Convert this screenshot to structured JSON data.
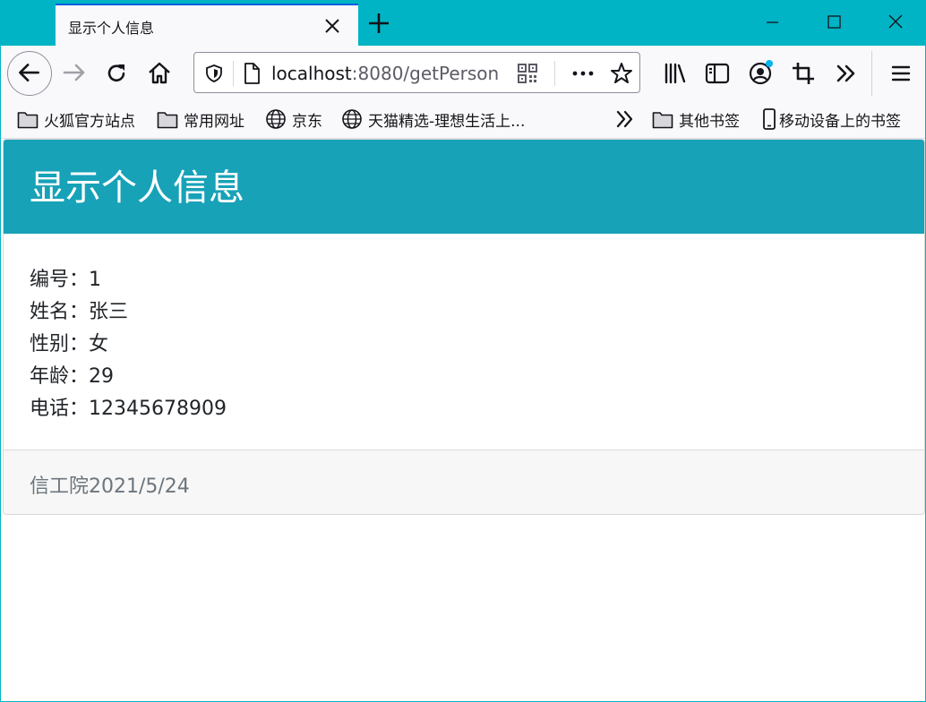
{
  "browser": {
    "tab": {
      "title": "显示个人信息"
    },
    "url": {
      "host": "localhost",
      "path": ":8080/getPerson"
    },
    "bookmarks": [
      {
        "label": "火狐官方站点",
        "icon": "folder-icon"
      },
      {
        "label": "常用网址",
        "icon": "folder-icon"
      },
      {
        "label": "京东",
        "icon": "globe-icon"
      },
      {
        "label": "天猫精选-理想生活上...",
        "icon": "globe-icon"
      },
      {
        "label": "其他书签",
        "icon": "folder-icon"
      },
      {
        "label": "移动设备上的书签",
        "icon": "mobile-icon"
      }
    ],
    "colors": {
      "titlebar": "#00b4c5",
      "accent_dot": "#00b4f0"
    }
  },
  "page": {
    "header": {
      "title": "显示个人信息"
    },
    "info": [
      {
        "label": "编号：",
        "value": "1"
      },
      {
        "label": "姓名：",
        "value": "张三"
      },
      {
        "label": "性别：",
        "value": "女"
      },
      {
        "label": "年龄：",
        "value": "29"
      },
      {
        "label": "电话：",
        "value": "12345678909"
      }
    ],
    "footer": {
      "text": "信工院2021/5/24"
    },
    "colors": {
      "header_bg": "#17a2b8",
      "footer_bg": "#f7f7f7"
    }
  }
}
